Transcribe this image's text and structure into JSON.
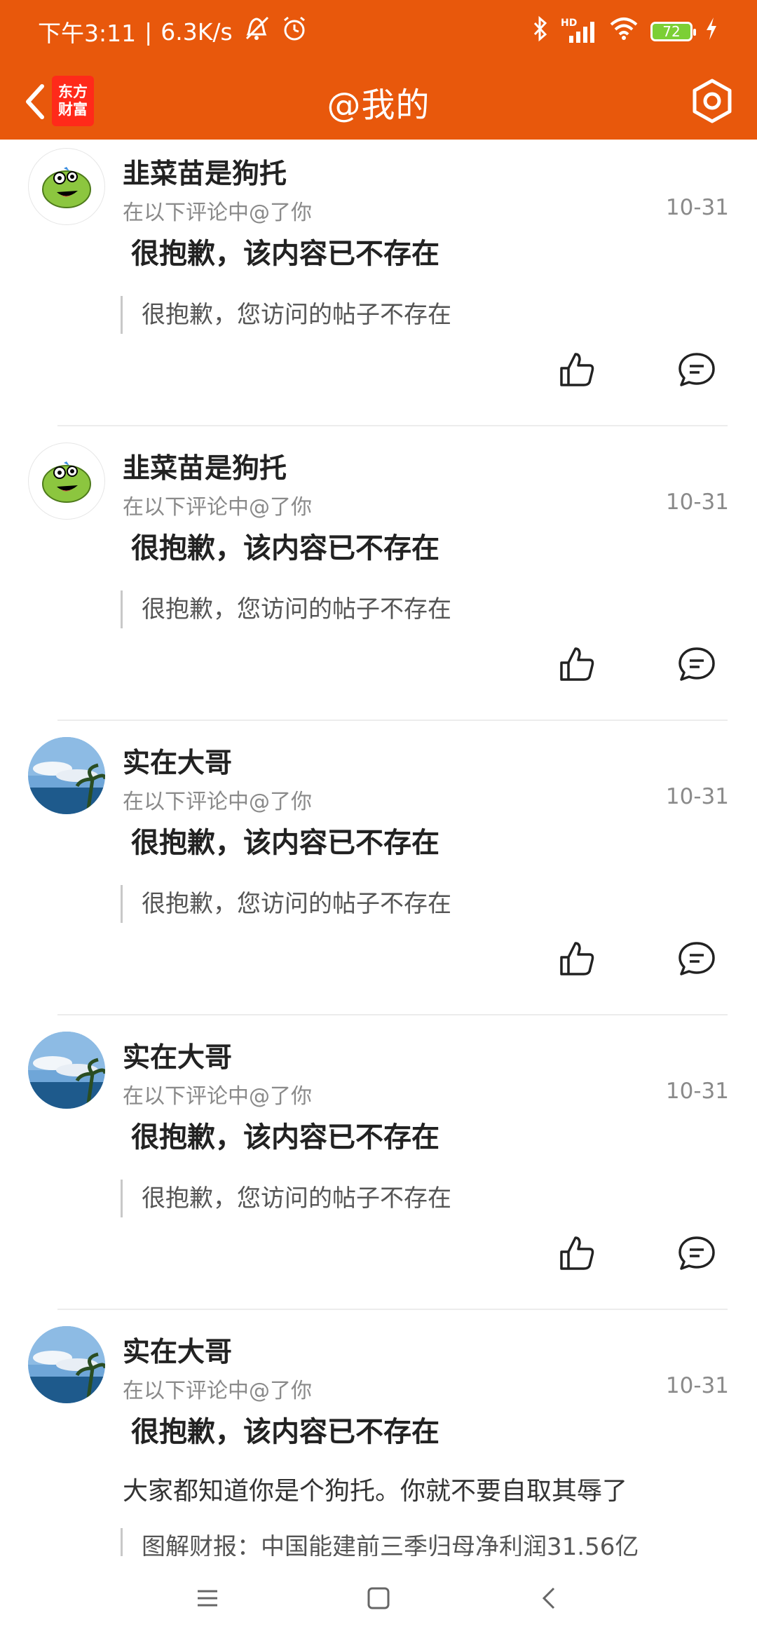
{
  "status_bar": {
    "time": "下午3:11",
    "speed": "6.3K/s",
    "hd_label": "HD",
    "battery_level": "72"
  },
  "nav": {
    "title": "@我的",
    "logo_line1": "东方",
    "logo_line2": "财富"
  },
  "posts": [
    {
      "username": "韭菜苗是狗托",
      "subline": "在以下评论中@了你",
      "date": "10-31",
      "deleted_notice": "很抱歉，该内容已不存在",
      "quote": "很抱歉，您访问的帖子不存在",
      "avatar_icon": "frog-avatar"
    },
    {
      "username": "韭菜苗是狗托",
      "subline": "在以下评论中@了你",
      "date": "10-31",
      "deleted_notice": "很抱歉，该内容已不存在",
      "quote": "很抱歉，您访问的帖子不存在",
      "avatar_icon": "frog-avatar"
    },
    {
      "username": "实在大哥",
      "subline": "在以下评论中@了你",
      "date": "10-31",
      "deleted_notice": "很抱歉，该内容已不存在",
      "quote": "很抱歉，您访问的帖子不存在",
      "avatar_icon": "beach-avatar"
    },
    {
      "username": "实在大哥",
      "subline": "在以下评论中@了你",
      "date": "10-31",
      "deleted_notice": "很抱歉，该内容已不存在",
      "quote": "很抱歉，您访问的帖子不存在",
      "avatar_icon": "beach-avatar"
    },
    {
      "username": "实在大哥",
      "subline": "在以下评论中@了你",
      "date": "10-31",
      "deleted_notice": "很抱歉，该内容已不存在",
      "body": "大家都知道你是个狗托。你就不要自取其辱了",
      "quote": "图解财报：中国能建前三季归母净利润31.56亿",
      "avatar_icon": "beach-avatar"
    }
  ],
  "colors": {
    "header_bg": "#E8580C",
    "logo_bg": "#FF2A1A"
  }
}
